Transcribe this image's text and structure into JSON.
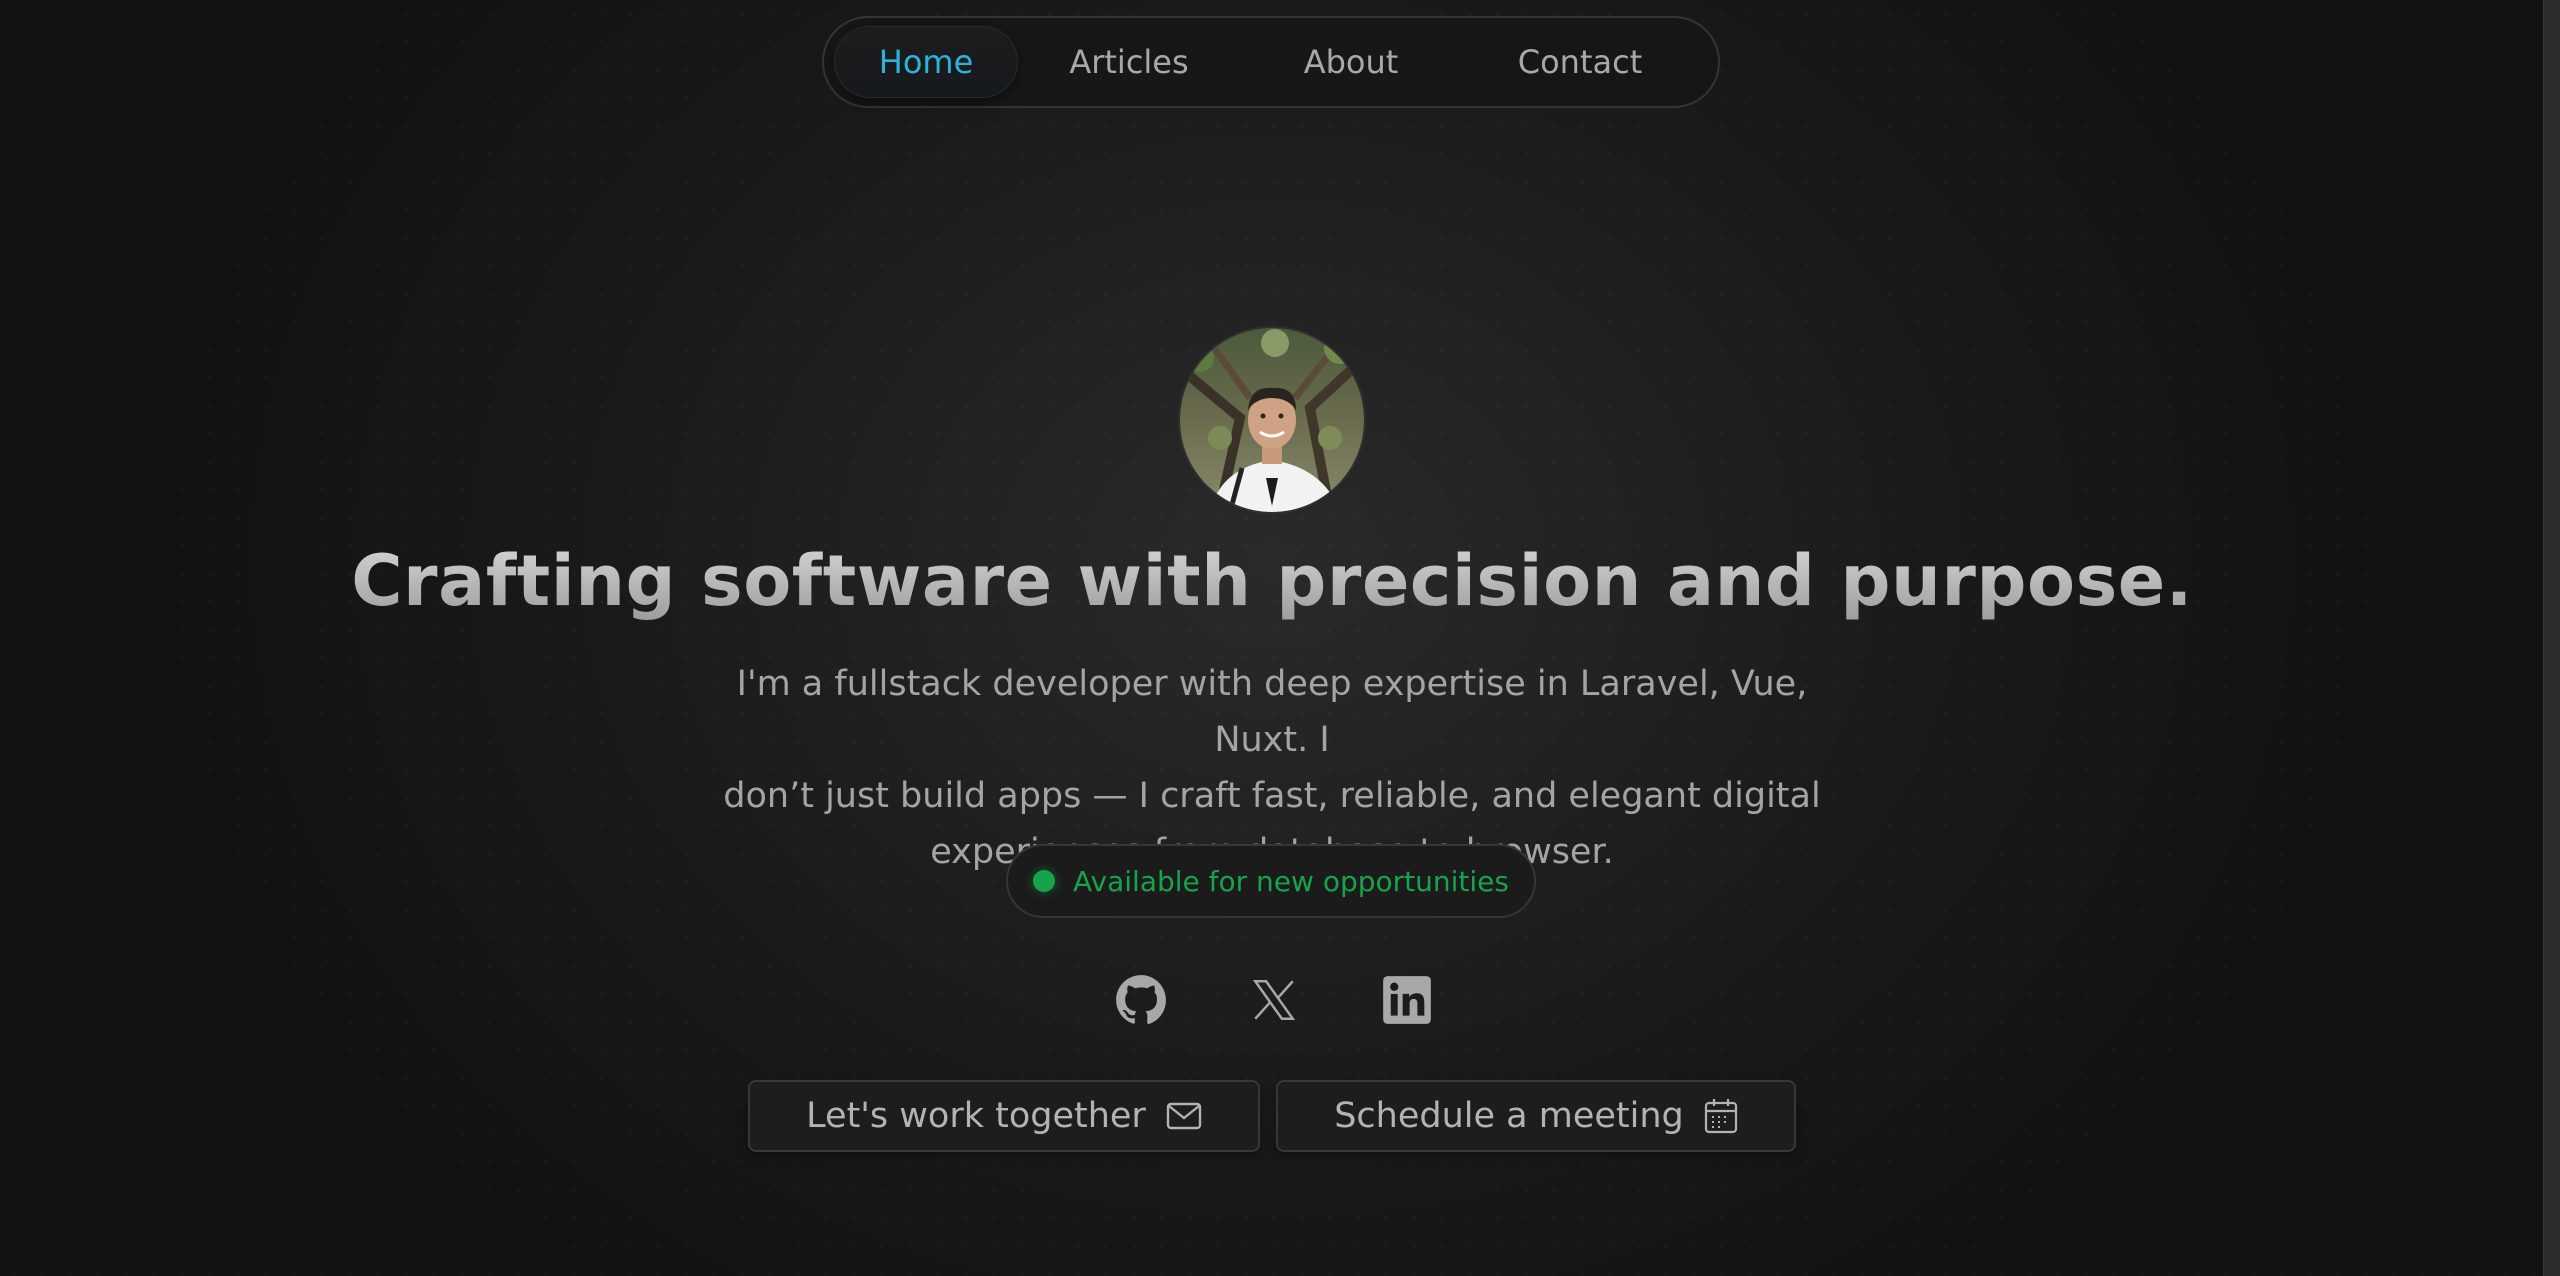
{
  "nav": {
    "items": [
      {
        "label": "Home",
        "active": true
      },
      {
        "label": "Articles",
        "active": false
      },
      {
        "label": "About",
        "active": false
      },
      {
        "label": "Contact",
        "active": false
      }
    ]
  },
  "hero": {
    "headline": "Crafting software with precision and purpose.",
    "bio_lines": [
      "I'm a fullstack developer with deep expertise in Laravel, Vue, Nuxt. I",
      "don’t just build apps — I craft fast, reliable, and elegant digital",
      "experiences from database to browser."
    ],
    "status": {
      "text": "Available for new opportunities",
      "color": "#16a34a"
    }
  },
  "socials": [
    {
      "icon": "github-icon"
    },
    {
      "icon": "x-icon"
    },
    {
      "icon": "linkedin-icon"
    }
  ],
  "actions": {
    "work_label": "Let's work together",
    "work_icon": "mail-icon",
    "meeting_label": "Schedule a meeting",
    "meeting_icon": "calendar-icon"
  },
  "colors": {
    "accent": "#2bb3d9",
    "available": "#16a34a",
    "background": "#1a1a1a"
  }
}
